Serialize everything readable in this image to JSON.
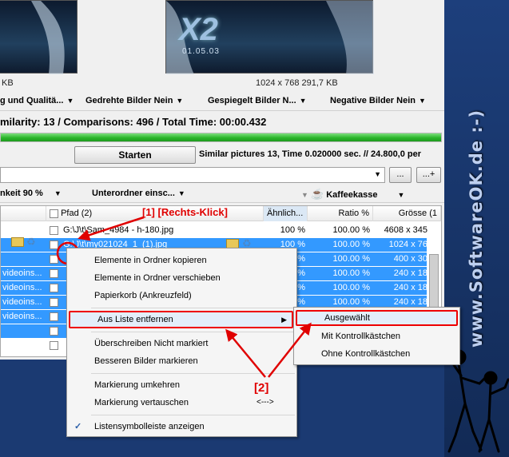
{
  "brand": {
    "site": "www.SoftwareOK.de :-)"
  },
  "thumbs": {
    "left_info": "KB",
    "right_info": "1024 x 768 291,7 KB",
    "right_art_title": "X2",
    "right_art_date": "01.05.03"
  },
  "options_bar": {
    "quality": "g und Qualitä...",
    "rotated": "Gedrehte Bilder Nein",
    "mirrored": "Gespiegelt Bilder N...",
    "negative": "Negative Bilder Nein"
  },
  "stats": "milarity: 13 / Comparisons: 496 / Total Time: 00:00.432",
  "progress": 100,
  "start": {
    "label": "Starten",
    "status": "Similar pictures 13, Time 0.020000 sec. // 24.800,0 per"
  },
  "path_bar": {
    "value": "",
    "browse": "...",
    "add": "...+"
  },
  "filter_bar": {
    "similarity": "nkeit 90 %",
    "subfolders": "Unterordner einsc...",
    "coffee": "Kaffeekasse"
  },
  "table": {
    "headers": {
      "path": "Pfad (2)",
      "similar": "Ähnlich...",
      "ratio": "Ratio %",
      "size": "Grösse (1"
    },
    "rows": [
      {
        "left": "",
        "path": "G:\\J\\t\\Sam_4984 - h-180.jpg",
        "similar": "100 %",
        "ratio": "100.00 %",
        "size": "4608 x 345",
        "selected": false
      },
      {
        "left": "",
        "path": "G:\\J\\t\\my021024_1_(1).jpg",
        "similar": "100 %",
        "ratio": "100.00 %",
        "size": "1024 x 76",
        "selected": true
      },
      {
        "left": "",
        "path": "",
        "similar": "100 %",
        "ratio": "100.00 %",
        "size": "400 x 30",
        "selected": true
      },
      {
        "left": "videoins...",
        "path": "",
        "similar": "100 %",
        "ratio": "100.00 %",
        "size": "240 x 18",
        "selected": true
      },
      {
        "left": "videoins...",
        "path": "",
        "similar": "100 %",
        "ratio": "100.00 %",
        "size": "240 x 18",
        "selected": true
      },
      {
        "left": "videoins...",
        "path": "",
        "similar": "100 %",
        "ratio": "100.00 %",
        "size": "240 x 18",
        "selected": true
      },
      {
        "left": "videoins...",
        "path": "",
        "similar": "100 %",
        "ratio": "100.00 %",
        "size": "240 x 18",
        "selected": true
      },
      {
        "left": "",
        "path": "",
        "similar": "100 %",
        "ratio": "100.00 %",
        "size": "240 x 18",
        "selected": true
      },
      {
        "left": "",
        "path": "",
        "similar": "",
        "ratio": "100.00 %",
        "size": "240 x 18",
        "selected": false
      }
    ]
  },
  "context_menu": {
    "copy": "Elemente in Ordner kopieren",
    "move": "Elemente in Ordner verschieben",
    "recycle": "Papierkorb (Ankreuzfeld)",
    "remove": "Aus Liste entfernen",
    "overwrite": "Überschreiben Nicht markiert",
    "better": "Besseren Bilder markieren",
    "invert": "Markierung umkehren",
    "swap": "Markierung vertauschen",
    "swap_hint": "<--->",
    "toolbar": "Listensymbolleiste anzeigen"
  },
  "submenu": {
    "selected": "Ausgewählt",
    "with_cb": "Mit Kontrollkästchen",
    "without_cb": "Ohne Kontrollkästchen"
  },
  "annotations": {
    "step1": "[1] [Rechts-Klick]",
    "step2": "[2]",
    "red": "#ee0000"
  }
}
